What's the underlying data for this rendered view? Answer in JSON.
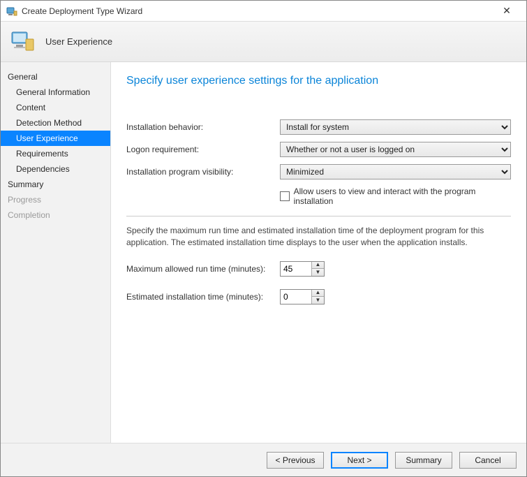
{
  "window": {
    "title": "Create Deployment Type Wizard",
    "banner_title": "User Experience"
  },
  "nav": {
    "groups": [
      {
        "label": "General",
        "disabled": false,
        "items": [
          {
            "label": "General Information",
            "selected": false
          },
          {
            "label": "Content",
            "selected": false
          },
          {
            "label": "Detection Method",
            "selected": false
          },
          {
            "label": "User Experience",
            "selected": true
          },
          {
            "label": "Requirements",
            "selected": false
          },
          {
            "label": "Dependencies",
            "selected": false
          }
        ]
      },
      {
        "label": "Summary",
        "disabled": false,
        "items": []
      },
      {
        "label": "Progress",
        "disabled": true,
        "items": []
      },
      {
        "label": "Completion",
        "disabled": true,
        "items": []
      }
    ]
  },
  "main": {
    "heading": "Specify user experience settings for the application",
    "install_behavior": {
      "label": "Installation behavior:",
      "value": "Install for system"
    },
    "logon_req": {
      "label": "Logon requirement:",
      "value": "Whether or not a user is logged on"
    },
    "visibility": {
      "label": "Installation program visibility:",
      "value": "Minimized"
    },
    "allow_interact": {
      "label": "Allow users to view and interact with the program installation",
      "checked": false
    },
    "time_desc": "Specify the maximum run time and estimated installation time of the deployment program for this application. The estimated installation time displays to the user when the application installs.",
    "max_runtime": {
      "label": "Maximum allowed run time (minutes):",
      "value": "45"
    },
    "est_time": {
      "label": "Estimated installation time (minutes):",
      "value": "0"
    }
  },
  "footer": {
    "previous": "< Previous",
    "next": "Next >",
    "summary": "Summary",
    "cancel": "Cancel"
  }
}
